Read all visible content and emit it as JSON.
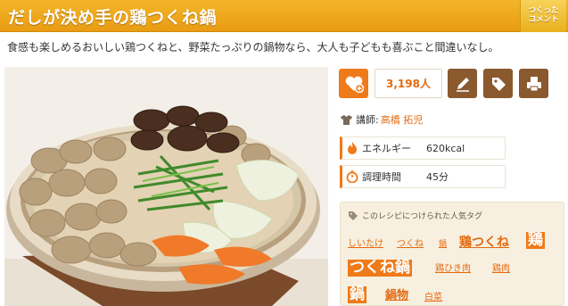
{
  "header": {
    "title": "だしが決め手の鶏つくね鍋",
    "comment_button": [
      "つくった",
      "コメント"
    ]
  },
  "description": "食感も楽しめるおいしい鶏つくねと、野菜たっぷりの鍋物なら、大人も子どもも喜ぶこと間違いなし。",
  "actions": {
    "heart_icon": "heart-plus-icon",
    "like_count": "3,198人",
    "pencil_icon": "pencil-icon",
    "tag_icon": "tag-icon",
    "print_icon": "printer-icon"
  },
  "lecturer": {
    "label": "講師:",
    "name": "高橋 拓児"
  },
  "info": [
    {
      "icon": "fire-icon",
      "label": "エネルギー",
      "value": "620kcal"
    },
    {
      "icon": "timer-icon",
      "label": "調理時間",
      "value": "45分"
    }
  ],
  "tags": {
    "heading": "このレシピにつけられた人気タグ",
    "items": [
      "しいたけ",
      "つくね",
      "鍋",
      "鶏つくね",
      "鶏",
      "つくね鍋",
      "鶏ひき肉",
      "鶏肉",
      "鍋",
      "鍋物",
      "白菜"
    ]
  },
  "colors": {
    "accent": "#ee7a1a",
    "title_bar": "#eca01a",
    "brown": "#8a5a2e"
  }
}
